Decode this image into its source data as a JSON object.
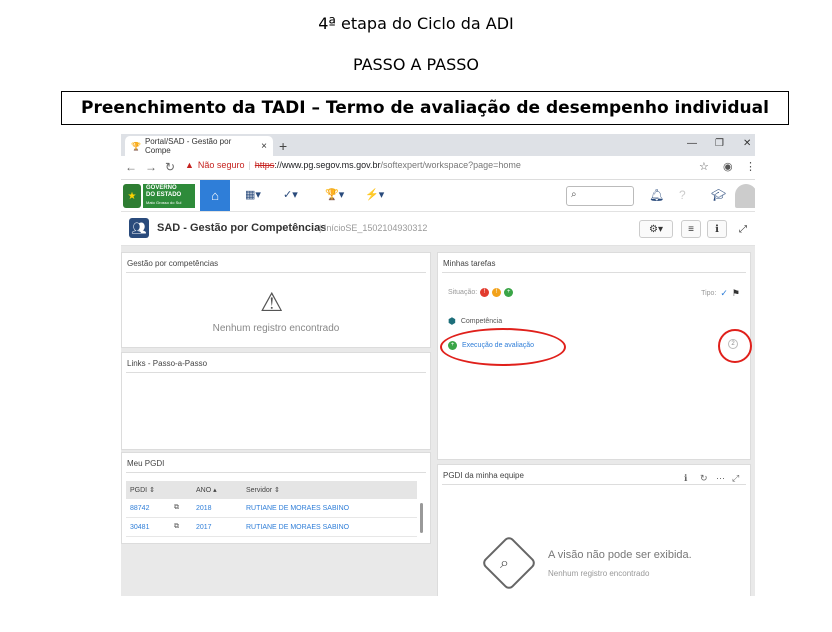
{
  "doc": {
    "title_line1": "4ª etapa do Ciclo da ADI",
    "title_line2": "PASSO A PASSO",
    "boxed_heading": "Preenchimento da TADI – Termo de avaliação de desempenho individual"
  },
  "browser": {
    "tab_title": "Portal/SAD - Gestão por Compe",
    "tab_close": "×",
    "new_tab": "+",
    "security_label": "Não seguro",
    "url_scheme": "https",
    "url_host": "://www.pg.segov.ms.gov.br",
    "url_path": "/softexpert/workspace?page=home"
  },
  "app": {
    "gov_logo_line1": "GOVERNO",
    "gov_logo_line2": "DO ESTADO",
    "gov_logo_line3": "Mato Grosso do Sul",
    "page_title": "SAD - Gestão por Competências",
    "page_subtitle": "| InícioSE_1502104930312"
  },
  "panels": {
    "gestao": {
      "title": "Gestão por competências",
      "empty": "Nenhum registro encontrado"
    },
    "links": {
      "title": "Links - Passo-a-Passo"
    },
    "tarefas": {
      "title": "Minhas tarefas",
      "situacao_label": "Situação:",
      "tipo_label": "Tipo:",
      "task1": "Competência",
      "task2": "Execução de avaliação",
      "task2_count": "2"
    },
    "meu_pgdi": {
      "title": "Meu PGDI",
      "headers": [
        "PGDI",
        "ANO",
        "Servidor"
      ],
      "rows": [
        {
          "pgdi": "88742",
          "ano": "2018",
          "servidor": "RUTIANE DE MORAES SABINO"
        },
        {
          "pgdi": "30481",
          "ano": "2017",
          "servidor": "RUTIANE DE MORAES SABINO"
        }
      ]
    },
    "equipe": {
      "title": "PGDI da minha equipe",
      "message": "A visão não pode ser exibida.",
      "sub": "Nenhum registro encontrado"
    }
  },
  "colors": {
    "accent": "#2f7ed8",
    "highlight": "#e0201b",
    "gov_green": "#2e8b3a"
  }
}
